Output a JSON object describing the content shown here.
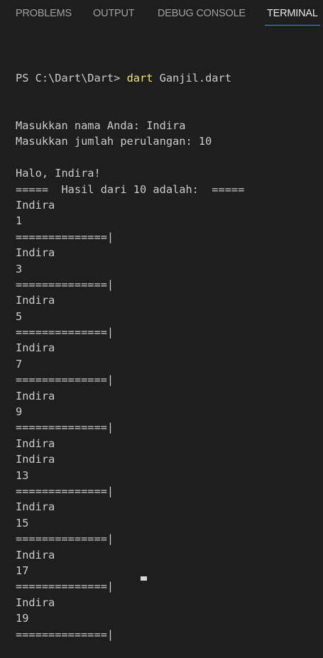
{
  "tabs": [
    {
      "label": "PROBLEMS",
      "active": false
    },
    {
      "label": "OUTPUT",
      "active": false
    },
    {
      "label": "DEBUG CONSOLE",
      "active": false
    },
    {
      "label": "TERMINAL",
      "active": true
    }
  ],
  "colors": {
    "background": "#1e1e1e",
    "text": "#cccccc",
    "command": "#f2e56b",
    "tab_inactive": "#a0a0a0",
    "tab_active": "#e7e7e7",
    "tab_underline": "#3794ff"
  },
  "terminal": {
    "prompt": "PS C:\\Dart\\Dart> ",
    "command": "dart",
    "args": " Ganjil.dart",
    "lines": [
      "Masukkan nama Anda: Indira",
      "Masukkan jumlah perulangan: 10",
      "",
      "Halo, Indira!",
      "=====  Hasil dari 10 adalah:  =====",
      "Indira",
      "1",
      "==============|",
      "Indira",
      "3",
      "==============|",
      "Indira",
      "5",
      "==============|",
      "Indira",
      "7",
      "==============|",
      "Indira",
      "9",
      "==============|",
      "Indira",
      "Indira",
      "13",
      "==============|",
      "Indira",
      "15",
      "==============|",
      "Indira",
      "17",
      "==============|",
      "Indira",
      "19",
      "==============|"
    ]
  }
}
